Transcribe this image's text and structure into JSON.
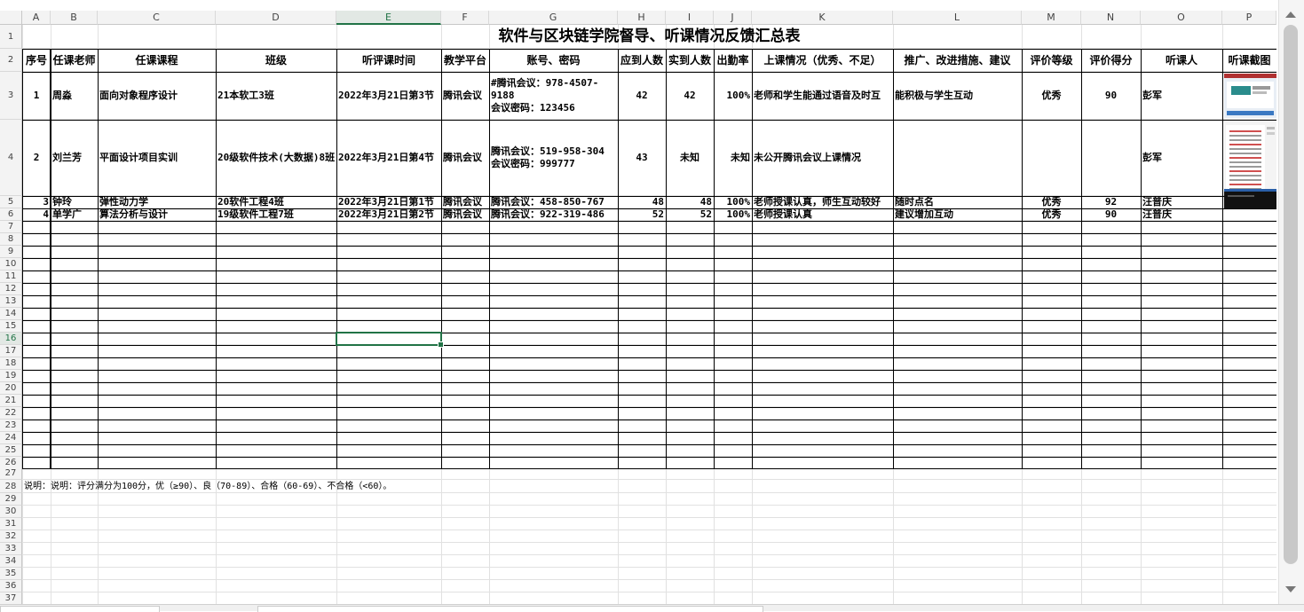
{
  "columns": [
    "A",
    "B",
    "C",
    "D",
    "E",
    "F",
    "G",
    "H",
    "I",
    "J",
    "K",
    "L",
    "M",
    "N",
    "O",
    "P"
  ],
  "selected_column": "E",
  "selected_row": "16",
  "title": "软件与区块链学院督导、听课情况反馈汇总表",
  "headers": [
    "序号",
    "任课老师",
    "任课课程",
    "班级",
    "听评课时间",
    "教学平台",
    "账号、密码",
    "应到人数",
    "实到人数",
    "出勤率",
    "上课情况（优秀、不足）",
    "推广、改进措施、建议",
    "评价等级",
    "评价得分",
    "听课人",
    "听课截图"
  ],
  "records": [
    {
      "no": "1",
      "teacher": "周淼",
      "course": "面向对象程序设计",
      "cls": "21本软工3班",
      "time": "2022年3月21日第3节",
      "platform": "腾讯会议",
      "account1": "#腾讯会议：978-4507-",
      "account2": "9188",
      "account3": "会议密码：123456",
      "expected": "42",
      "actual": "42",
      "rate": "100%",
      "situation": "老师和学生能通过语音及时互",
      "suggestion": "能积极与学生互动",
      "grade": "优秀",
      "score": "90",
      "observer": "彭军"
    },
    {
      "no": "2",
      "teacher": "刘兰芳",
      "course": "平面设计项目实训",
      "cls": "20级软件技术(大数据)8班",
      "time": "2022年3月21日第4节",
      "platform": "腾讯会议",
      "account1": "腾讯会议：519-958-304",
      "account2": "会议密码：999777",
      "account3": "",
      "expected": "43",
      "actual": "未知",
      "rate": "未知",
      "situation": "未公开腾讯会议上课情况",
      "suggestion": "",
      "grade": "",
      "score": "",
      "observer": "彭军"
    },
    {
      "no": "3",
      "teacher": "钟玲",
      "course": "弹性动力学",
      "cls": "20软件工程4班",
      "time": "2022年3月21日第1节",
      "platform": "腾讯会议",
      "account1": "腾讯会议：458-850-767",
      "account2": "",
      "account3": "",
      "expected": "48",
      "actual": "48",
      "rate": "100%",
      "situation": "老师授课认真，师生互动较好",
      "suggestion": "随时点名",
      "grade": "优秀",
      "score": "92",
      "observer": "汪普庆"
    },
    {
      "no": "4",
      "teacher": "单学广",
      "course": "算法分析与设计",
      "cls": "19级软件工程7班",
      "time": "2022年3月21日第2节",
      "platform": "腾讯会议",
      "account1": "腾讯会议：922-319-486",
      "account2": "",
      "account3": "",
      "expected": "52",
      "actual": "52",
      "rate": "100%",
      "situation": "老师授课认真",
      "suggestion": "建议增加互动",
      "grade": "优秀",
      "score": "90",
      "observer": "汪普庆"
    }
  ],
  "note": "说明：说明：评分满分为100分，优（≥90）、良（70-89）、合格（60-69）、不合格（<60）。",
  "row_numbers": [
    "1",
    "2",
    "3",
    "4",
    "5",
    "6",
    "7",
    "8",
    "9",
    "10",
    "11",
    "12",
    "13",
    "14",
    "15",
    "16",
    "17",
    "18",
    "19",
    "20",
    "21",
    "22",
    "23",
    "24",
    "25",
    "26",
    "27",
    "28",
    "29",
    "30",
    "31",
    "32",
    "33",
    "34",
    "35",
    "36",
    "37"
  ]
}
